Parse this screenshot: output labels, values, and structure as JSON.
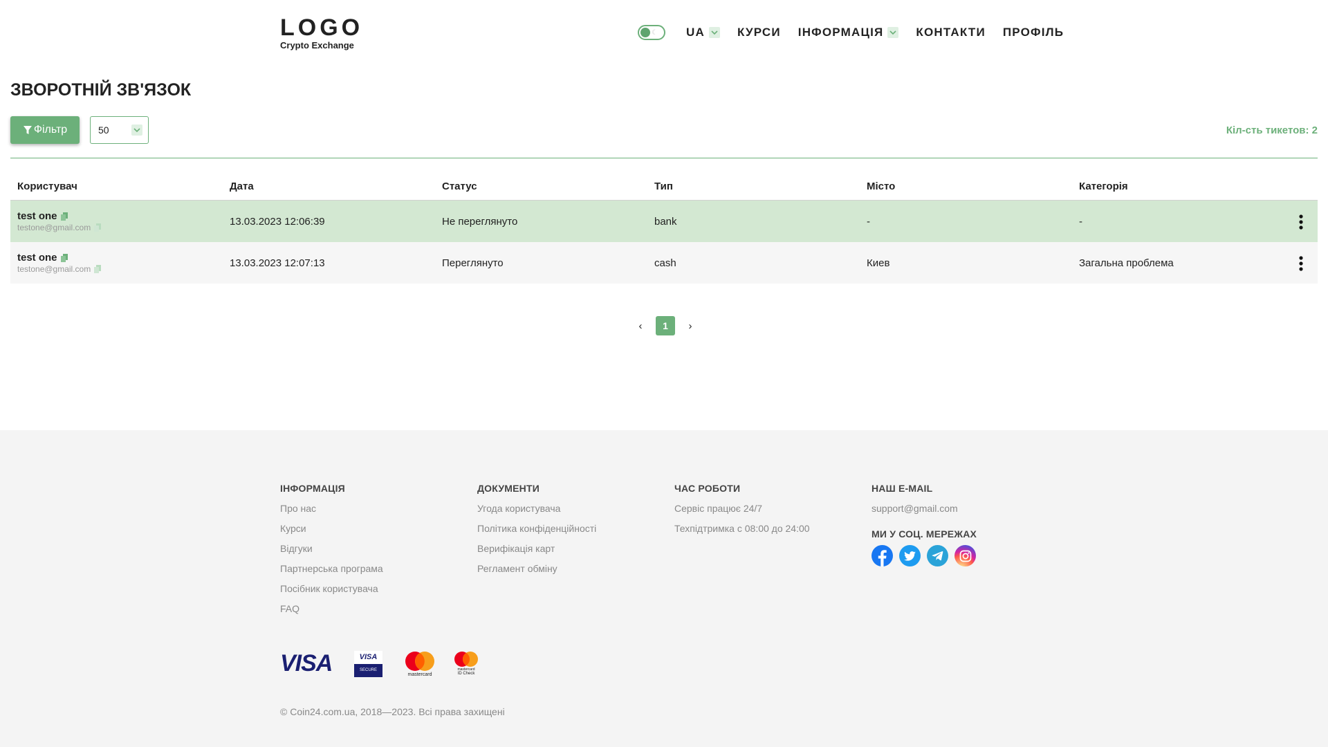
{
  "header": {
    "logo_main": "LOGO",
    "logo_sub": "Crypto Exchange",
    "lang": "UA",
    "nav": [
      "КУРСИ",
      "ІНФОРМАЦІЯ",
      "КОНТАКТИ",
      "ПРОФІЛЬ"
    ]
  },
  "page": {
    "title": "ЗВОРОТНІЙ ЗВ'ЯЗОК",
    "filter_label": "Фільтр",
    "per_page": "50",
    "ticket_count": "Кіл-сть тикетов: 2"
  },
  "table": {
    "headers": [
      "Користувач",
      "Дата",
      "Статус",
      "Тип",
      "Місто",
      "Категорія"
    ],
    "rows": [
      {
        "name": "test one",
        "email": "testone@gmail.com",
        "date": "13.03.2023 12:06:39",
        "status": "Не переглянуто",
        "type": "bank",
        "city": "-",
        "category": "-"
      },
      {
        "name": "test one",
        "email": "testone@gmail.com",
        "date": "13.03.2023 12:07:13",
        "status": "Переглянуто",
        "type": "cash",
        "city": "Киев",
        "category": "Загальна проблема"
      }
    ]
  },
  "pagination": {
    "prev": "‹",
    "current": "1",
    "next": "›"
  },
  "footer": {
    "info": {
      "title": "ІНФОРМАЦІЯ",
      "links": [
        "Про нас",
        "Курси",
        "Відгуки",
        "Партнерська програма",
        "Посібник користувача",
        "FAQ"
      ]
    },
    "docs": {
      "title": "ДОКУМЕНТИ",
      "links": [
        "Угода користувача",
        "Політика конфіденційності",
        "Верифікація карт",
        "Регламент обміну"
      ]
    },
    "hours": {
      "title": "ЧАС РОБОТИ",
      "lines": [
        "Сервіс працює 24/7",
        "Техпідтримка с 08:00 до 24:00"
      ]
    },
    "email": {
      "title": "НАШ E-MAIL",
      "value": "support@gmail.com"
    },
    "social": {
      "title": "МИ У СОЦ. МЕРЕЖАХ",
      "icons": [
        "facebook-icon",
        "twitter-icon",
        "telegram-icon",
        "instagram-icon"
      ]
    },
    "payment_logos": {
      "visa": "VISA",
      "visa_secure_top": "VISA",
      "visa_secure_bottom": "SECURE",
      "mastercard": "mastercard",
      "mc_idcheck_1": "mastercard",
      "mc_idcheck_2": "ID Check"
    },
    "copyright": "© Coin24.com.ua, 2018—2023. Всі права захищені"
  },
  "colors": {
    "accent": "#6cb07a",
    "row_highlight": "#d3e8d2",
    "footer_bg": "#f4f4f4"
  }
}
